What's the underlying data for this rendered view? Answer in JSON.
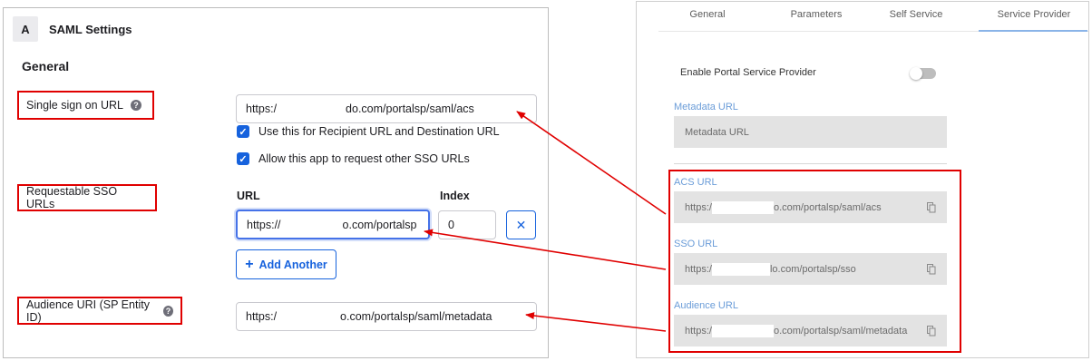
{
  "saml": {
    "section_letter": "A",
    "section_title": "SAML Settings",
    "general_title": "General",
    "sso_url_label": "Single sign on URL",
    "sso_url_value_prefix": "https:/",
    "sso_url_value_suffix": "do.com/portalsp/saml/acs",
    "use_recipient_label": "Use this for Recipient URL and Destination URL",
    "allow_request_label": "Allow this app to request other SSO URLs",
    "requestable_label": "Requestable SSO URLs",
    "url_col": "URL",
    "index_col": "Index",
    "requestable_url_prefix": "https://",
    "requestable_url_suffix": "o.com/portalsp",
    "index_value": "0",
    "remove_symbol": "✕",
    "add_another_label": "Add Another",
    "audience_label": "Audience URI (SP Entity ID)",
    "audience_value_prefix": "https:/",
    "audience_value_suffix": "o.com/portalsp/saml/metadata"
  },
  "service_provider": {
    "tabs": [
      "General",
      "Parameters",
      "Self Service",
      "Service Provider"
    ],
    "active_tab": "Service Provider",
    "enable_label": "Enable Portal Service Provider",
    "enable_state": "off",
    "metadata_label": "Metadata URL",
    "metadata_placeholder": "Metadata URL",
    "acs_label": "ACS URL",
    "acs_prefix": "https:/",
    "acs_suffix": "o.com/portalsp/saml/acs",
    "sso_label": "SSO URL",
    "sso_prefix": "https:/",
    "sso_suffix": "lo.com/portalsp/sso",
    "audience_label": "Audience URL",
    "audience_prefix": "https:/",
    "audience_suffix": "o.com/portalsp/saml/metadata"
  },
  "colors": {
    "highlight": "#e00000",
    "accent": "#1662dd",
    "field_label_blue": "#6a9cd8"
  },
  "icons": [
    "info-icon",
    "checkbox-checked-icon",
    "close-icon",
    "plus-icon",
    "copy-icon",
    "toggle-switch"
  ]
}
